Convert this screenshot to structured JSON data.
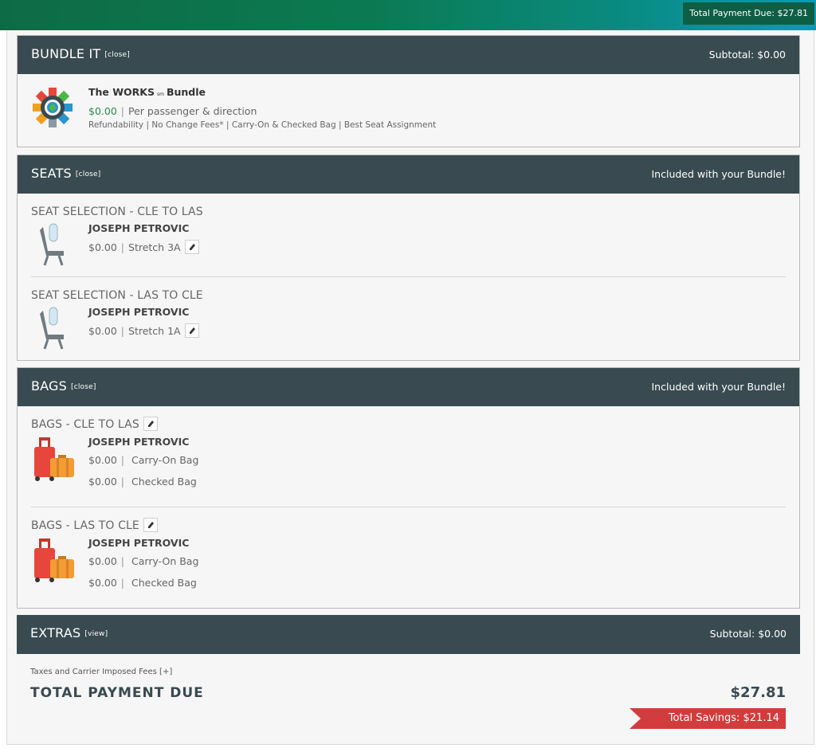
{
  "header": {
    "total_due": "Total Payment Due: $27.81"
  },
  "bundle": {
    "title": "BUNDLE IT",
    "close": "[close]",
    "subtotal": "Subtotal: $0.00",
    "name_main": "The WORKS",
    "name_sm": "sm",
    "name_suffix": "Bundle",
    "price": "$0.00",
    "price_note": "Per passenger & direction",
    "features": "Refundability | No Change Fees* | Carry-On & Checked Bag | Best Seat Assignment"
  },
  "seats": {
    "title": "SEATS",
    "close": "[close]",
    "status": "Included with your Bundle!",
    "items": [
      {
        "heading": "SEAT SELECTION - CLE TO LAS",
        "passenger": "JOSEPH PETROVIC",
        "price": "$0.00",
        "seat": "Stretch 3A"
      },
      {
        "heading": "SEAT SELECTION - LAS TO CLE",
        "passenger": "JOSEPH PETROVIC",
        "price": "$0.00",
        "seat": "Stretch 1A"
      }
    ]
  },
  "bags": {
    "title": "BAGS",
    "close": "[close]",
    "status": "Included with your Bundle!",
    "items": [
      {
        "heading": "BAGS - CLE TO LAS",
        "passenger": "JOSEPH PETROVIC",
        "carry_price": "$0.00",
        "carry_label": "Carry-On Bag",
        "checked_price": "$0.00",
        "checked_label": "Checked Bag"
      },
      {
        "heading": "BAGS - LAS TO CLE",
        "passenger": "JOSEPH PETROVIC",
        "carry_price": "$0.00",
        "carry_label": "Carry-On Bag",
        "checked_price": "$0.00",
        "checked_label": "Checked Bag"
      }
    ]
  },
  "extras": {
    "title": "EXTRAS",
    "view": "[view]",
    "subtotal": "Subtotal: $0.00"
  },
  "summary": {
    "fees_link": "Taxes and Carrier Imposed Fees [+]",
    "total_label": "TOTAL PAYMENT DUE",
    "total_amount": "$27.81",
    "savings": "Total Savings: $21.14"
  },
  "colors": {
    "header_bar": "#394a51",
    "accent_green": "#0b7a52",
    "savings_red": "#d33c3c"
  },
  "icons": [
    "gear-bundle-icon",
    "airplane-seat-icon",
    "luggage-icon",
    "pencil-icon"
  ]
}
